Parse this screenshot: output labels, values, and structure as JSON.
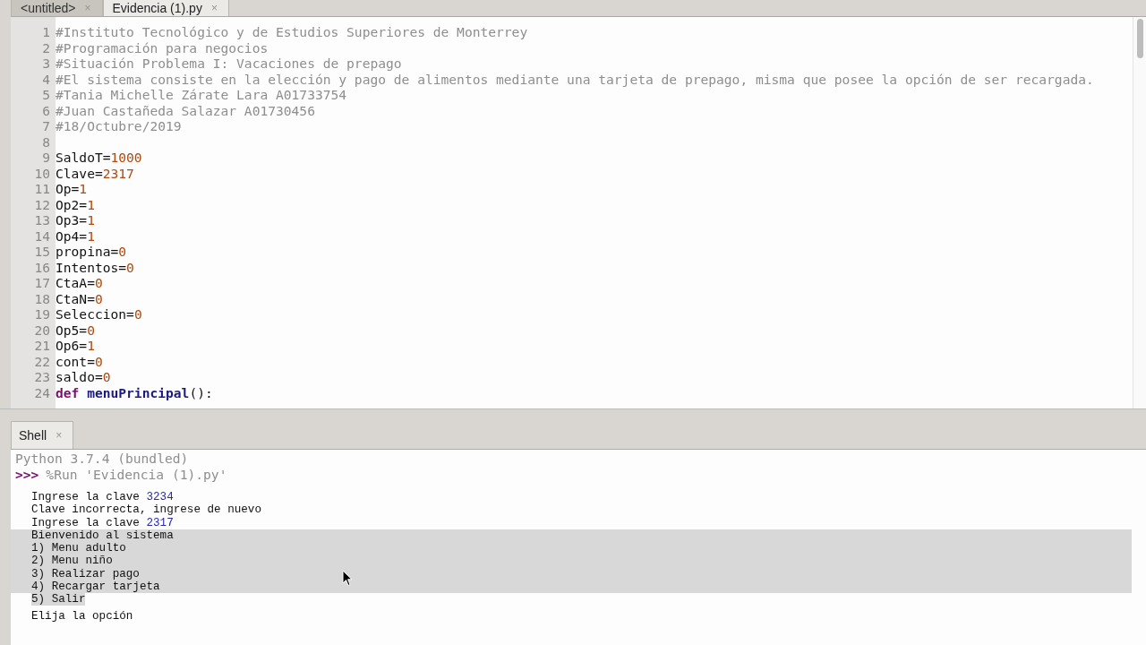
{
  "editor_tabs": [
    {
      "label": "<untitled>",
      "close": "×",
      "selected": false
    },
    {
      "label": "Evidencia (1).py",
      "close": "×",
      "selected": true
    }
  ],
  "editor": {
    "lines": [
      {
        "number": "1",
        "tokens": [
          {
            "kind": "comment",
            "text": "#Instituto Tecnológico y de Estudios Superiores de Monterrey"
          }
        ]
      },
      {
        "number": "2",
        "tokens": [
          {
            "kind": "comment",
            "text": "#Programación para negocios"
          }
        ]
      },
      {
        "number": "3",
        "tokens": [
          {
            "kind": "comment",
            "text": "#Situación Problema I: Vacaciones de prepago"
          }
        ]
      },
      {
        "number": "4",
        "tokens": [
          {
            "kind": "comment",
            "text": "#El sistema consiste en la elección y pago de alimentos mediante una tarjeta de prepago, misma que posee la opción de ser recargada."
          }
        ]
      },
      {
        "number": "5",
        "tokens": [
          {
            "kind": "comment",
            "text": "#Tania Michelle Zárate Lara A01733754"
          }
        ]
      },
      {
        "number": "6",
        "tokens": [
          {
            "kind": "comment",
            "text": "#Juan Castañeda Salazar A01730456"
          }
        ]
      },
      {
        "number": "7",
        "tokens": [
          {
            "kind": "comment",
            "text": "#18/Octubre/2019"
          }
        ]
      },
      {
        "number": "8"
      },
      {
        "number": "9",
        "tokens": [
          {
            "kind": "name",
            "text": "SaldoT="
          },
          {
            "kind": "number",
            "text": "1000"
          }
        ]
      },
      {
        "number": "10",
        "tokens": [
          {
            "kind": "name",
            "text": "Clave="
          },
          {
            "kind": "number",
            "text": "2317"
          }
        ]
      },
      {
        "number": "11",
        "tokens": [
          {
            "kind": "name",
            "text": "Op="
          },
          {
            "kind": "number",
            "text": "1"
          }
        ]
      },
      {
        "number": "12",
        "tokens": [
          {
            "kind": "name",
            "text": "Op2="
          },
          {
            "kind": "number",
            "text": "1"
          }
        ]
      },
      {
        "number": "13",
        "tokens": [
          {
            "kind": "name",
            "text": "Op3="
          },
          {
            "kind": "number",
            "text": "1"
          }
        ]
      },
      {
        "number": "14",
        "tokens": [
          {
            "kind": "name",
            "text": "Op4="
          },
          {
            "kind": "number",
            "text": "1"
          }
        ]
      },
      {
        "number": "15",
        "tokens": [
          {
            "kind": "name",
            "text": "propina="
          },
          {
            "kind": "number",
            "text": "0"
          }
        ]
      },
      {
        "number": "16",
        "tokens": [
          {
            "kind": "name",
            "text": "Intentos="
          },
          {
            "kind": "number",
            "text": "0"
          }
        ]
      },
      {
        "number": "17",
        "tokens": [
          {
            "kind": "name",
            "text": "CtaA="
          },
          {
            "kind": "number",
            "text": "0"
          }
        ]
      },
      {
        "number": "18",
        "tokens": [
          {
            "kind": "name",
            "text": "CtaN="
          },
          {
            "kind": "number",
            "text": "0"
          }
        ]
      },
      {
        "number": "19",
        "tokens": [
          {
            "kind": "name",
            "text": "Seleccion="
          },
          {
            "kind": "number",
            "text": "0"
          }
        ]
      },
      {
        "number": "20",
        "tokens": [
          {
            "kind": "name",
            "text": "Op5="
          },
          {
            "kind": "number",
            "text": "0"
          }
        ]
      },
      {
        "number": "21",
        "tokens": [
          {
            "kind": "name",
            "text": "Op6="
          },
          {
            "kind": "number",
            "text": "1"
          }
        ]
      },
      {
        "number": "22",
        "tokens": [
          {
            "kind": "name",
            "text": "cont="
          },
          {
            "kind": "number",
            "text": "0"
          }
        ]
      },
      {
        "number": "23",
        "tokens": [
          {
            "kind": "name",
            "text": "saldo="
          },
          {
            "kind": "number",
            "text": "0"
          }
        ]
      },
      {
        "number": "24",
        "tokens": [
          {
            "kind": "keyword",
            "text": "def"
          },
          {
            "kind": "function",
            "text": " menuPrincipal"
          },
          {
            "kind": "name",
            "text": "():"
          }
        ]
      }
    ]
  },
  "shell_tab": {
    "label": "Shell",
    "close": "×"
  },
  "shell": {
    "banner": "Python 3.7.4 (bundled)",
    "prompt": ">>>",
    "command": "%Run 'Evidencia (1).py'",
    "output": [
      {
        "selected": false,
        "tokens": [
          {
            "kind": "text",
            "text": "Ingrese la clave "
          },
          {
            "kind": "input",
            "text": "3234"
          }
        ]
      },
      {
        "selected": false,
        "tokens": [
          {
            "kind": "text",
            "text": "Clave incorrecta, ingrese de nuevo"
          }
        ]
      },
      {
        "selected": false,
        "tokens": [
          {
            "kind": "text",
            "text": "Ingrese la clave "
          },
          {
            "kind": "input",
            "text": "2317"
          }
        ]
      },
      {
        "selected": true,
        "tokens": [
          {
            "kind": "text",
            "text": "Bienvenido al sistema"
          }
        ]
      },
      {
        "selected": true,
        "tokens": [
          {
            "kind": "text",
            "text": "1) Menu adulto"
          }
        ]
      },
      {
        "selected": true,
        "tokens": [
          {
            "kind": "text",
            "text": "2) Menu niño"
          }
        ]
      },
      {
        "selected": true,
        "tokens": [
          {
            "kind": "text",
            "text": "3) Realizar pago"
          }
        ]
      },
      {
        "selected": true,
        "tokens": [
          {
            "kind": "text",
            "text": "4) Recargar tarjeta"
          }
        ]
      },
      {
        "selected": true,
        "tokens": [
          {
            "kind": "text",
            "text": "5) Salir"
          }
        ]
      },
      {
        "selected": false,
        "tokens": [
          {
            "kind": "text",
            "text": "Elija la opción"
          }
        ]
      }
    ]
  }
}
